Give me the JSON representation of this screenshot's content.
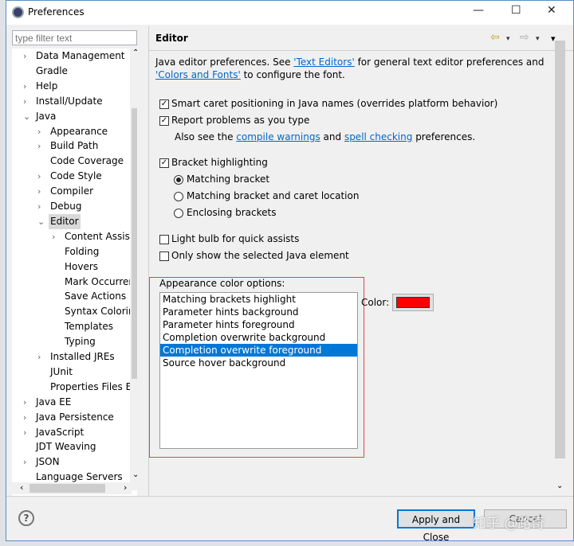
{
  "window": {
    "title": "Preferences",
    "minimize": "—",
    "maximize": "☐",
    "close": "✕"
  },
  "filter": {
    "placeholder": "type filter text"
  },
  "tree": [
    {
      "label": "Data Management",
      "level": 0,
      "arrow": "›"
    },
    {
      "label": "Gradle",
      "level": 0,
      "arrow": ""
    },
    {
      "label": "Help",
      "level": 0,
      "arrow": "›"
    },
    {
      "label": "Install/Update",
      "level": 0,
      "arrow": "›"
    },
    {
      "label": "Java",
      "level": 0,
      "arrow": "⌄"
    },
    {
      "label": "Appearance",
      "level": 1,
      "arrow": "›"
    },
    {
      "label": "Build Path",
      "level": 1,
      "arrow": "›"
    },
    {
      "label": "Code Coverage",
      "level": 1,
      "arrow": ""
    },
    {
      "label": "Code Style",
      "level": 1,
      "arrow": "›"
    },
    {
      "label": "Compiler",
      "level": 1,
      "arrow": "›"
    },
    {
      "label": "Debug",
      "level": 1,
      "arrow": "›"
    },
    {
      "label": "Editor",
      "level": 1,
      "arrow": "⌄",
      "selected": true
    },
    {
      "label": "Content Assist",
      "level": 2,
      "arrow": "›"
    },
    {
      "label": "Folding",
      "level": 2,
      "arrow": ""
    },
    {
      "label": "Hovers",
      "level": 2,
      "arrow": ""
    },
    {
      "label": "Mark Occurrences",
      "level": 2,
      "arrow": ""
    },
    {
      "label": "Save Actions",
      "level": 2,
      "arrow": ""
    },
    {
      "label": "Syntax Coloring",
      "level": 2,
      "arrow": ""
    },
    {
      "label": "Templates",
      "level": 2,
      "arrow": ""
    },
    {
      "label": "Typing",
      "level": 2,
      "arrow": ""
    },
    {
      "label": "Installed JREs",
      "level": 1,
      "arrow": "›"
    },
    {
      "label": "JUnit",
      "level": 1,
      "arrow": ""
    },
    {
      "label": "Properties Files Editor",
      "level": 1,
      "arrow": ""
    },
    {
      "label": "Java EE",
      "level": 0,
      "arrow": "›"
    },
    {
      "label": "Java Persistence",
      "level": 0,
      "arrow": "›"
    },
    {
      "label": "JavaScript",
      "level": 0,
      "arrow": "›"
    },
    {
      "label": "JDT Weaving",
      "level": 0,
      "arrow": ""
    },
    {
      "label": "JSON",
      "level": 0,
      "arrow": "›"
    },
    {
      "label": "Language Servers",
      "level": 0,
      "arrow": ""
    }
  ],
  "page": {
    "title": "Editor",
    "nav": {
      "back": "⇦",
      "forward": "⇨",
      "menu": "▾"
    },
    "intro_1": "Java editor preferences. See ",
    "link_text_editors": "'Text Editors'",
    "intro_2": " for general text editor preferences and ",
    "link_colors_fonts": "'Colors and Fonts'",
    "intro_3": " to configure the font.",
    "smart_caret": {
      "label": "Smart caret positioning in Java names (overrides platform behavior)",
      "checked": true
    },
    "report_problems": {
      "label": "Report problems as you type",
      "checked": true
    },
    "also_1": "Also see the ",
    "link_compile_warnings": "compile warnings",
    "also_2": " and ",
    "link_spell_checking": "spell checking",
    "also_3": " preferences.",
    "bracket_highlighting": {
      "label": "Bracket highlighting",
      "checked": true
    },
    "radios": [
      {
        "label": "Matching bracket",
        "selected": true
      },
      {
        "label": "Matching bracket and caret location",
        "selected": false
      },
      {
        "label": "Enclosing brackets",
        "selected": false
      }
    ],
    "light_bulb": {
      "label": "Light bulb for quick assists",
      "checked": false
    },
    "only_selected": {
      "label": "Only show the selected Java element",
      "checked": false
    },
    "appearance_label": "Appearance color options:",
    "appearance_items": [
      "Matching brackets highlight",
      "Parameter hints background",
      "Parameter hints foreground",
      "Completion overwrite background",
      "Completion overwrite foreground",
      "Source hover background"
    ],
    "selected_index": 4,
    "color_label": "Color:",
    "color_value": "#ff0000"
  },
  "footer": {
    "help": "?",
    "apply_close": "Apply and Close",
    "cancel": "Cancel",
    "watermark": "知乎 @路奇"
  }
}
